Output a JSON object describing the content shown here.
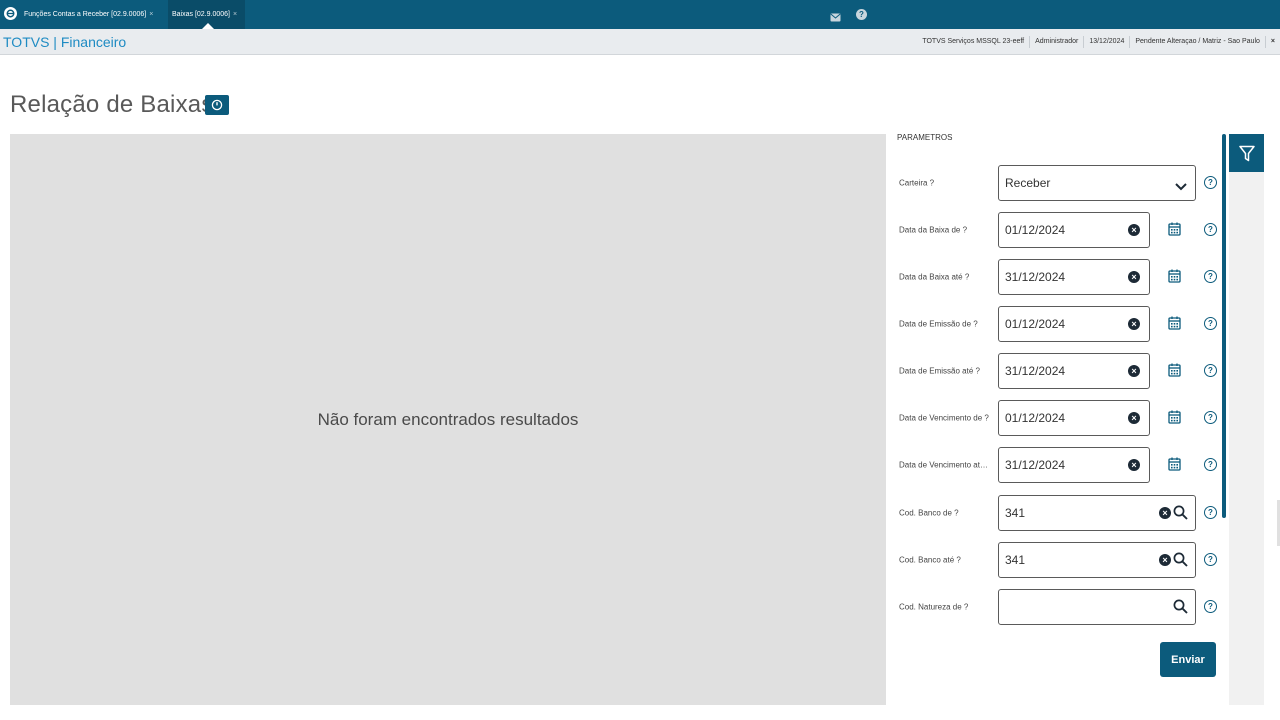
{
  "tabs": [
    {
      "label": "Funções Contas a Receber [02.9.0006]",
      "close": "×"
    },
    {
      "label": "Baixas [02.9.0006]",
      "close": "×"
    }
  ],
  "header": {
    "brand": "TOTVS | Financeiro",
    "info": [
      "TOTVS Serviços MSSQL 23-eeff",
      "Administrador",
      "13/12/2024",
      "Pendente Alteraçao / Matriz - Sao Paulo"
    ],
    "close": "×"
  },
  "page": {
    "title": "Relação de Baixas",
    "empty_message": "Não foram encontrados resultados"
  },
  "params": {
    "title": "PARAMETROS",
    "rows": [
      {
        "label": "Carteira ?",
        "value": "Receber",
        "type": "select"
      },
      {
        "label": "Data da Baixa de ?",
        "value": "01/12/2024",
        "type": "date"
      },
      {
        "label": "Data da Baixa até ?",
        "value": "31/12/2024",
        "type": "date"
      },
      {
        "label": "Data de Emissão de ?",
        "value": "01/12/2024",
        "type": "date"
      },
      {
        "label": "Data de Emissão até ?",
        "value": "31/12/2024",
        "type": "date"
      },
      {
        "label": "Data de Vencimento de ?",
        "value": "01/12/2024",
        "type": "date"
      },
      {
        "label": "Data de Vencimento até ?",
        "value": "31/12/2024",
        "type": "date"
      },
      {
        "label": "Cod. Banco de ?",
        "value": "341",
        "type": "lookup"
      },
      {
        "label": "Cod. Banco até ?",
        "value": "341",
        "type": "lookup"
      },
      {
        "label": "Cod. Natureza de ?",
        "value": "",
        "type": "lookup-empty"
      }
    ],
    "help_glyph": "?",
    "clear_glyph": "×",
    "send_label": "Enviar"
  },
  "colors": {
    "primary": "#0c5b7c",
    "brand_text": "#1e8bc3",
    "panel_gray": "#e0e0e0"
  }
}
